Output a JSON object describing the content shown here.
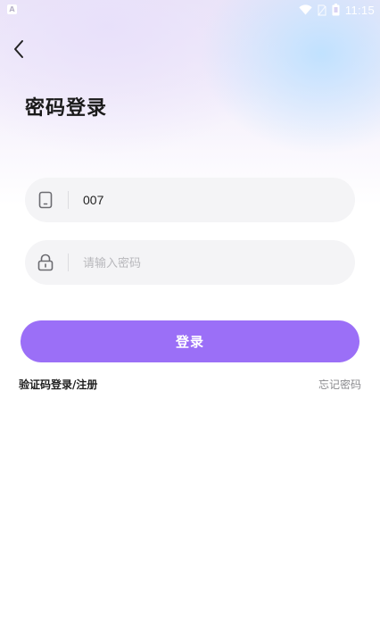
{
  "status_bar": {
    "time": "11:15",
    "left_icon": "A"
  },
  "header": {
    "title": "密码登录"
  },
  "form": {
    "phone": {
      "value": "007",
      "icon": "phone-icon"
    },
    "password": {
      "value": "",
      "placeholder": "请输入密码",
      "icon": "lock-icon"
    }
  },
  "actions": {
    "login_label": "登录",
    "sms_login_label": "验证码登录/注册",
    "forgot_password_label": "忘记密码"
  },
  "colors": {
    "accent": "#9b6ff7",
    "field_bg": "#f4f4f6",
    "link_muted": "#8a8a8e"
  }
}
